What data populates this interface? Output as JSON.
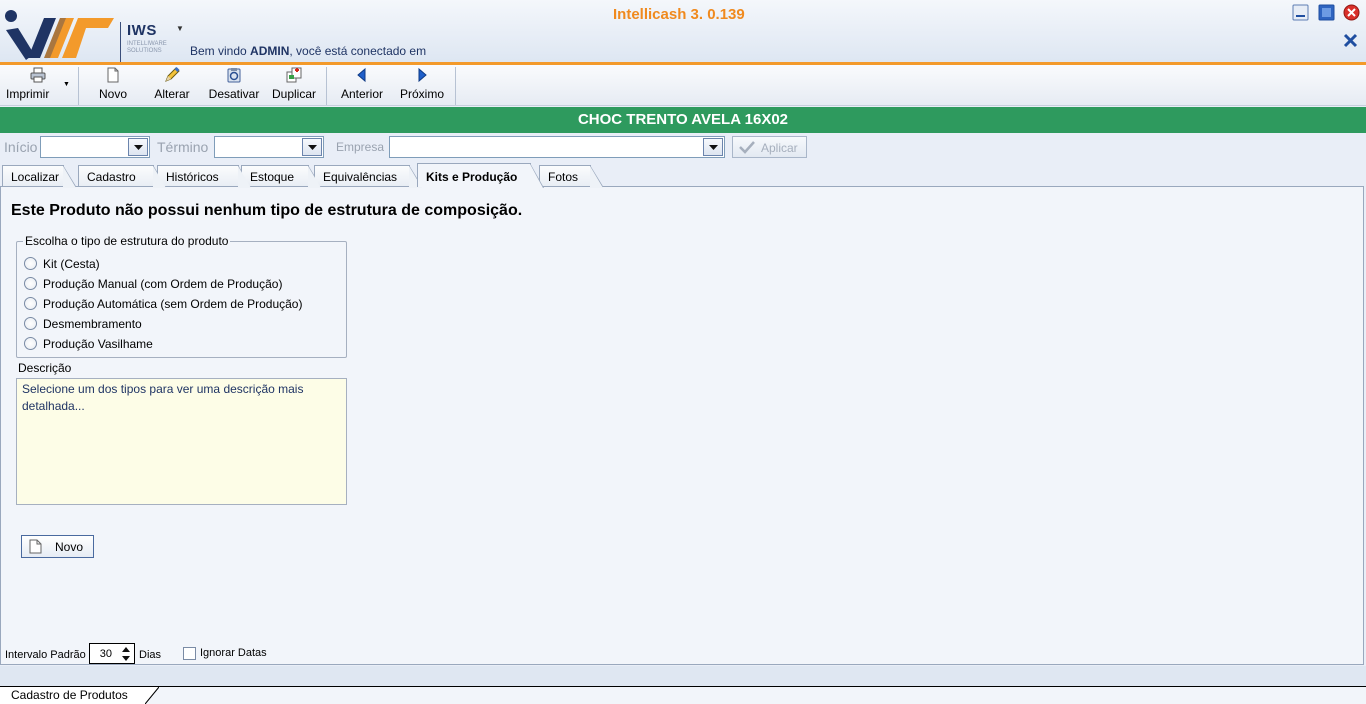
{
  "window": {
    "title": "Intellicash 3. 0.139",
    "brand_name": "IWS",
    "brand_sub": "INTELLIWARE SOLUTIONS",
    "welcome_prefix": "Bem vindo ",
    "welcome_user": "ADMIN",
    "welcome_suffix": ", você está conectado em"
  },
  "toolbar": {
    "print_label": "Imprimir",
    "new_label": "Novo",
    "edit_label": "Alterar",
    "deactivate_label": "Desativar",
    "duplicate_label": "Duplicar",
    "previous_label": "Anterior",
    "next_label": "Próximo"
  },
  "product": {
    "name": "CHOC TRENTO AVELA 16X02"
  },
  "filters": {
    "start_label": "Início",
    "start_value": "",
    "end_label": "Término",
    "end_value": "",
    "company_label": "Empresa",
    "company_value": "",
    "apply_label": "Aplicar"
  },
  "tabs": [
    {
      "label": "Localizar"
    },
    {
      "label": "Cadastro"
    },
    {
      "label": "Históricos"
    },
    {
      "label": "Estoque"
    },
    {
      "label": "Equivalências"
    },
    {
      "label": "Kits e Produção"
    },
    {
      "label": "Fotos"
    }
  ],
  "active_tab": "Kits e Produção",
  "content": {
    "heading": "Este Produto não possui nenhum tipo de estrutura de composição.",
    "group_title": "Escolha o tipo de estrutura do produto",
    "options": [
      {
        "label": "Kit (Cesta)"
      },
      {
        "label": "Produção Manual (com Ordem de Produção)"
      },
      {
        "label": "Produção Automática (sem Ordem de Produção)"
      },
      {
        "label": "Desmembramento"
      },
      {
        "label": "Produção Vasilhame"
      }
    ],
    "description_label": "Descrição",
    "description_text": "Selecione um dos tipos para ver uma descrição mais detalhada...",
    "new_button_label": "Novo"
  },
  "footer": {
    "interval_label": "Intervalo Padrão",
    "interval_value": "30",
    "days_label": "Dias",
    "ignore_dates_label": "Ignorar Datas",
    "ignore_dates_checked": false
  },
  "doc_tab": {
    "label": "Cadastro de Produtos"
  },
  "colors": {
    "accent_orange": "#f08a1e",
    "product_bar_green": "#2e9a5e",
    "brand_navy": "#1f3464",
    "description_bg": "#fdfde7"
  },
  "icons": [
    "printer-icon",
    "new-document-icon",
    "edit-pencil-icon",
    "deactivate-icon",
    "duplicate-icon",
    "arrow-left-icon",
    "arrow-right-icon",
    "checkmark-icon",
    "minimize-icon",
    "maximize-icon",
    "close-icon"
  ]
}
